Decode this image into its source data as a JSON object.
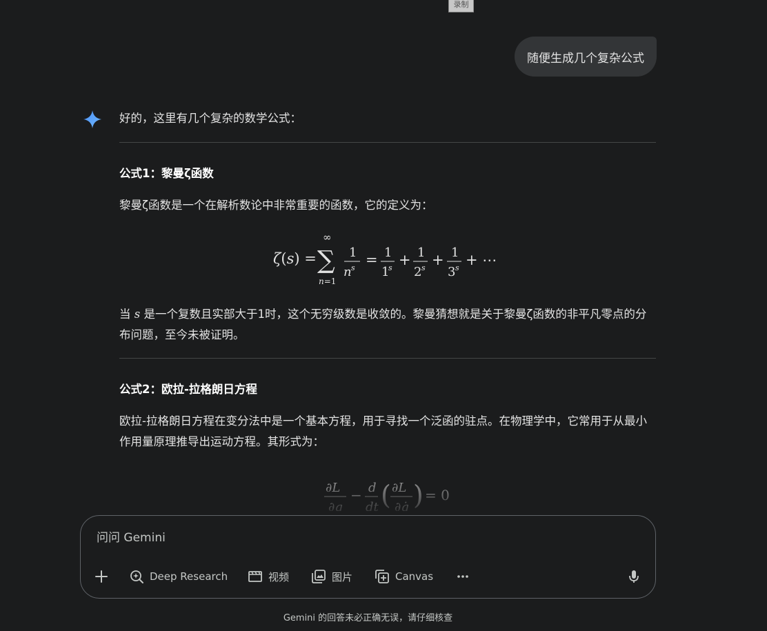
{
  "recording_badge": "录制",
  "user_message": "随便生成几个复杂公式",
  "response": {
    "intro": "好的，这里有几个复杂的数学公式：",
    "formula1": {
      "title": "公式1：黎曼ζ函数",
      "description": "黎曼ζ函数是一个在解析数论中非常重要的函数，它的定义为：",
      "explanation_before_var": "当 ",
      "explanation_var": "s",
      "explanation_after_var": " 是一个复数且实部大于1时，这个无穷级数是收敛的。黎曼猜想就是关于黎曼ζ函数的非平凡零点的分布问题，至今未被证明。"
    },
    "formula2": {
      "title": "公式2：欧拉-拉格朗日方程",
      "description": "欧拉-拉格朗日方程在变分法中是一个基本方程，用于寻找一个泛函的驻点。在物理学中，它常用于从最小作用量原理推导出运动方程。其形式为："
    }
  },
  "input": {
    "placeholder": "问问 Gemini"
  },
  "toolbar": {
    "add_icon": "plus-icon",
    "deep_research_label": "Deep Research",
    "video_label": "视频",
    "image_label": "图片",
    "canvas_label": "Canvas",
    "more_icon": "more-horizontal-icon",
    "mic_icon": "microphone-icon"
  },
  "footer": "Gemini 的回答未必正确无误，请仔细核查",
  "colors": {
    "background": "#1b1c1d",
    "bubble": "#333537",
    "accent_blue": "#4b90f5",
    "divider": "#444746"
  }
}
